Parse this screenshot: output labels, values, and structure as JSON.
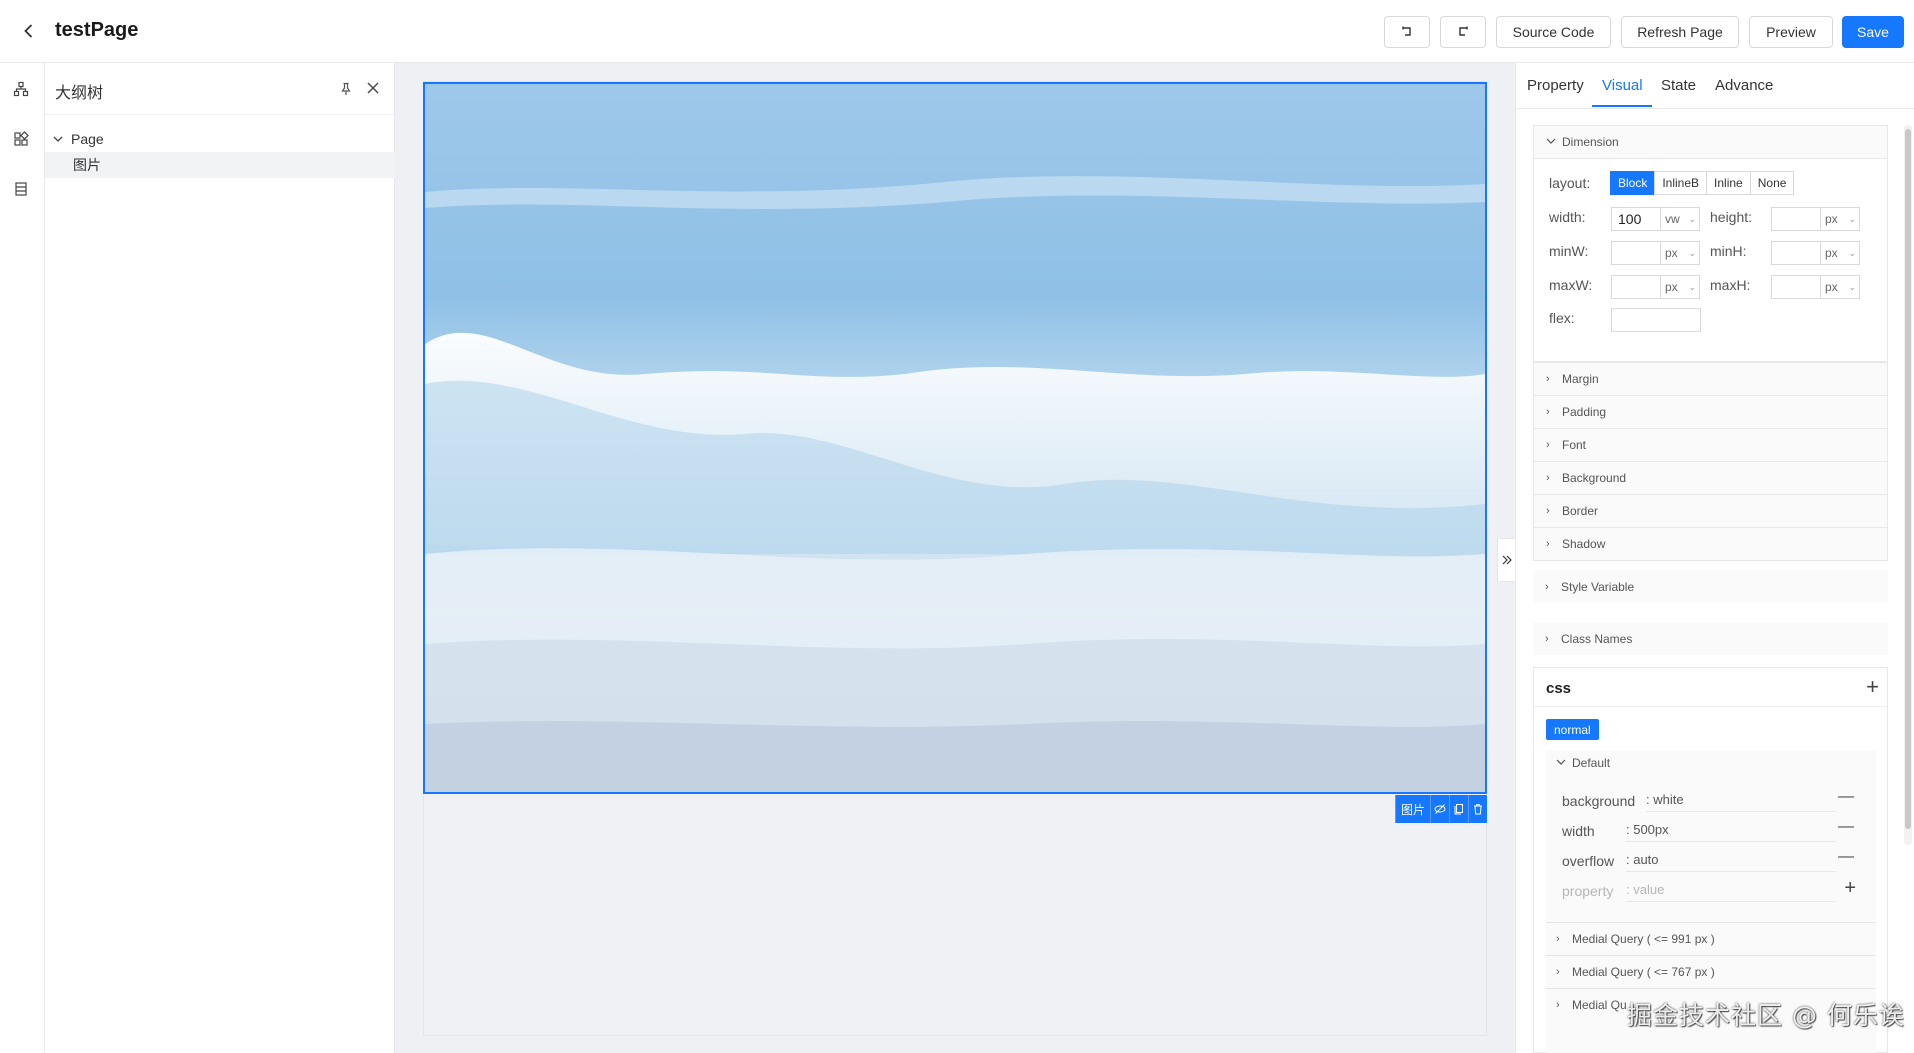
{
  "header": {
    "title": "testPage",
    "buttons": {
      "undo_icon": "undo-icon",
      "redo_icon": "redo-icon",
      "source_code": "Source Code",
      "refresh": "Refresh Page",
      "preview": "Preview",
      "save": "Save"
    }
  },
  "rail": {
    "icons": [
      "component-tree-icon",
      "components-icon",
      "datasource-icon"
    ]
  },
  "outline": {
    "title": "大纲树",
    "tree": [
      {
        "label": "Page",
        "expanded": true
      },
      {
        "label": "图片",
        "selected": true
      }
    ]
  },
  "canvas": {
    "image_alt": "ocean wave",
    "toolbar": {
      "label": "图片"
    }
  },
  "right": {
    "tabs": [
      "Property",
      "Visual",
      "State",
      "Advance"
    ],
    "active_tab": "Visual",
    "dimension": {
      "title": "Dimension",
      "layout_label": "layout:",
      "layout_options": [
        "Block",
        "InlineB",
        "Inline",
        "None"
      ],
      "layout_selected": "Block",
      "width_label": "width:",
      "width_value": "100",
      "width_unit": "vw",
      "height_label": "height:",
      "height_unit": "px",
      "minw_label": "minW:",
      "minw_unit": "px",
      "minh_label": "minH:",
      "minh_unit": "px",
      "maxw_label": "maxW:",
      "maxw_unit": "px",
      "maxh_label": "maxH:",
      "maxh_unit": "px",
      "flex_label": "flex:"
    },
    "collapsed_sections": [
      "Margin",
      "Padding",
      "Font",
      "Background",
      "Border",
      "Shadow"
    ],
    "style_variable": "Style Variable",
    "class_names": "Class Names",
    "css": {
      "title": "css",
      "state_tag": "normal",
      "default_title": "Default",
      "rules": [
        {
          "key": "background",
          "value": ": white"
        },
        {
          "key": "width",
          "value": ": 500px"
        },
        {
          "key": "overflow",
          "value": ": auto"
        }
      ],
      "new_key_placeholder": "property",
      "new_value_placeholder": ": value",
      "media_queries": [
        "Medial Query ( <= 991 px )",
        "Medial Query ( <= 767 px )",
        "Medial Qu"
      ]
    }
  },
  "watermark": "掘金技术社区 @ 何乐诶",
  "colors": {
    "accent": "#1677ff"
  }
}
